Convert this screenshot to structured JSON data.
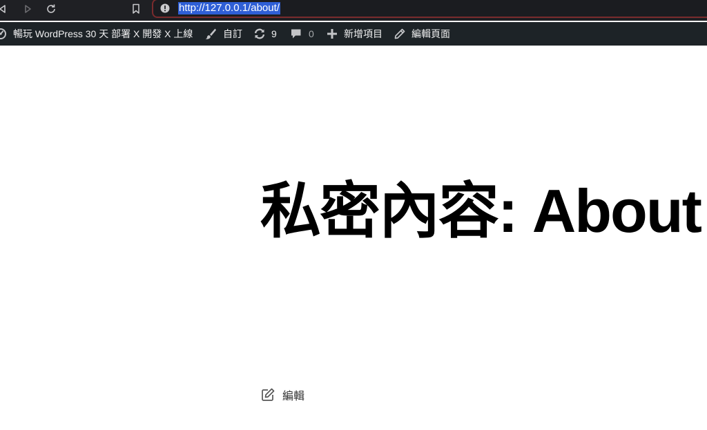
{
  "browser": {
    "url": "http://127.0.0.1/about/"
  },
  "admin_bar": {
    "site_name": "暢玩 WordPress 30 天 部署 X 開發 X 上線",
    "customize": "自訂",
    "updates_count": "9",
    "comments_count": "0",
    "new_item": "新增項目",
    "edit_page": "編輯頁面"
  },
  "content": {
    "title": "私密內容: About",
    "edit_label": "編輯"
  },
  "colors": {
    "admin_bar_bg": "#1d2327",
    "browser_bar_bg": "#1f2024",
    "url_highlight": "#2f5fd6",
    "url_border": "#7a2b2d"
  }
}
